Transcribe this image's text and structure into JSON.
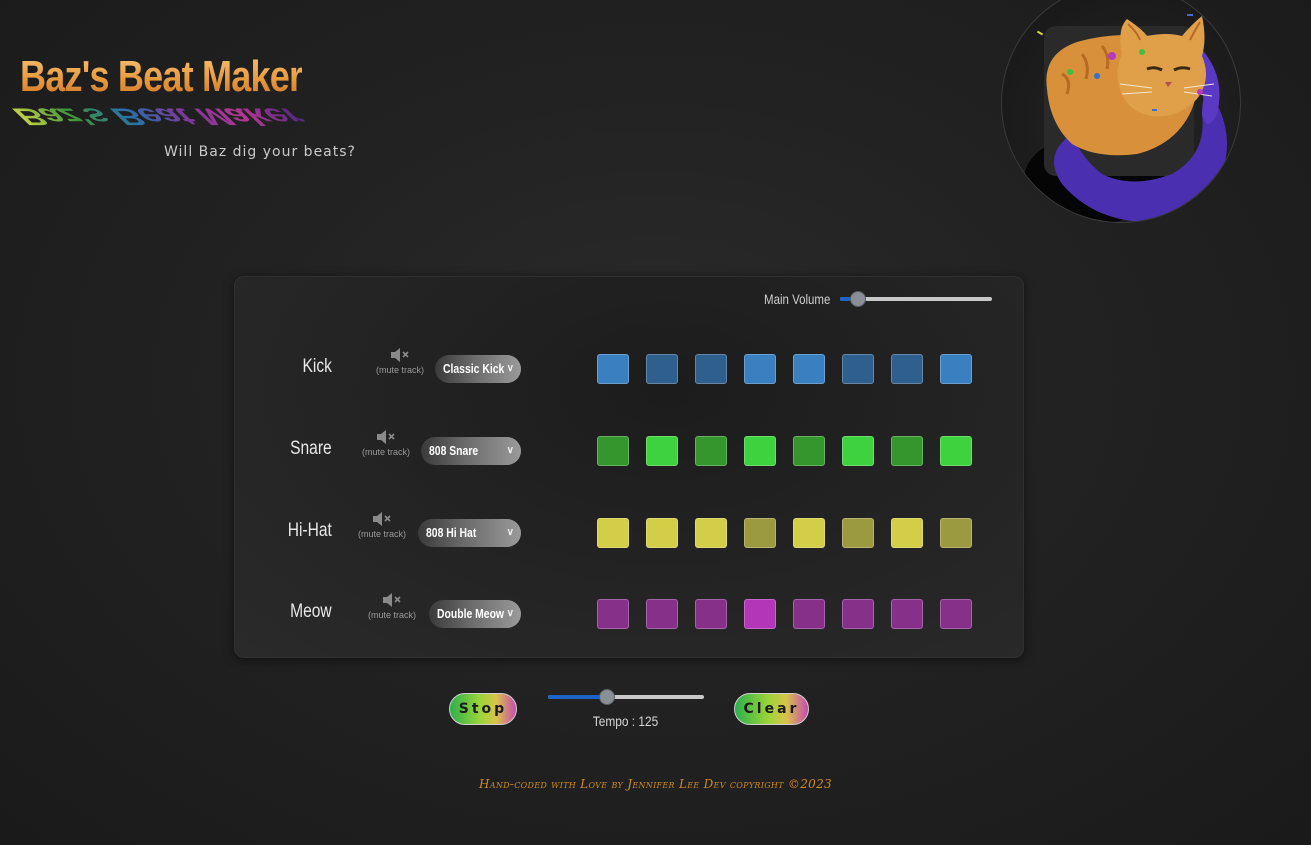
{
  "header": {
    "title": "Baz's Beat Maker",
    "subtitle": "Will Baz dig your beats?"
  },
  "avatar": {
    "icon": "cat-in-boa-icon"
  },
  "main_volume": {
    "label": "Main Volume",
    "value": 0.12
  },
  "tracks": [
    {
      "name": "Kick",
      "mute_label": "(mute track)",
      "sound": "Classic Kick",
      "pads": [
        1,
        0,
        0,
        1,
        1,
        0,
        0,
        1
      ],
      "color_on": "#3a7fc0",
      "color_off": "#2f5f8c"
    },
    {
      "name": "Snare",
      "mute_label": "(mute track)",
      "sound": "808 Snare",
      "pads": [
        0,
        1,
        0,
        1,
        0,
        1,
        0,
        1
      ],
      "color_on": "#3ed23e",
      "color_off": "#36962e"
    },
    {
      "name": "Hi-Hat",
      "mute_label": "(mute track)",
      "sound": "808 Hi Hat",
      "pads": [
        1,
        1,
        1,
        0,
        1,
        0,
        1,
        0
      ],
      "color_on": "#d2ce48",
      "color_off": "#9c9a40"
    },
    {
      "name": "Meow",
      "mute_label": "(mute track)",
      "sound": "Double Meow",
      "pads": [
        0,
        0,
        0,
        1,
        0,
        0,
        0,
        0
      ],
      "color_on": "#b336b8",
      "color_off": "#86308a"
    }
  ],
  "transport": {
    "stop_label": "Stop",
    "clear_label": "Clear",
    "tempo_label": "Tempo : 125",
    "tempo_value": 0.38
  },
  "footer": {
    "text": "Hand-coded with Love by Jennifer Lee Dev copyright ©2023"
  }
}
